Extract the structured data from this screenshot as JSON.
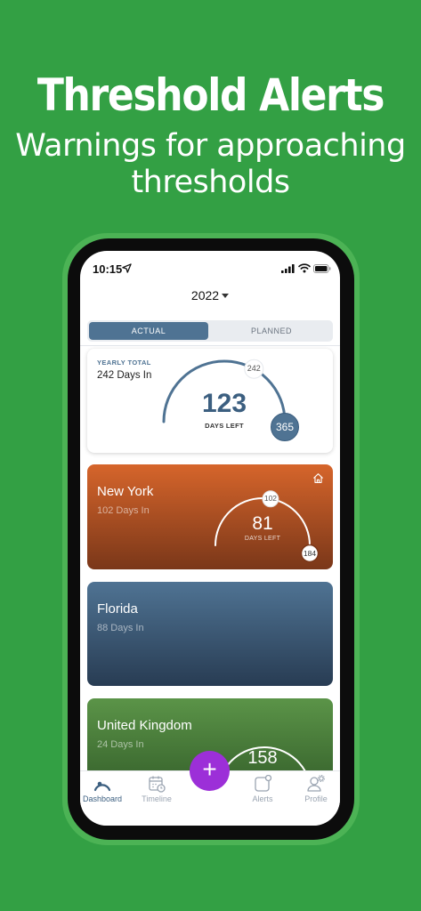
{
  "promo": {
    "title": "Threshold Alerts",
    "subtitle_line1": "Warnings for approaching",
    "subtitle_line2": "thresholds"
  },
  "status_bar": {
    "time": "10:15"
  },
  "year_selector": {
    "value": "2022"
  },
  "segmented": {
    "actual": "ACTUAL",
    "planned": "PLANNED",
    "selected": "ACTUAL"
  },
  "yearly_total": {
    "label": "YEARLY TOTAL",
    "days_in": "242 Days In",
    "days_left": "123",
    "days_left_label": "DAYS LEFT",
    "current_marker": "242",
    "max_marker": "365",
    "progress": 0.663
  },
  "locations": [
    {
      "name": "New York",
      "days_in": "102 Days In",
      "days_left": "81",
      "days_left_label": "DAYS LEFT",
      "current_marker": "102",
      "max_marker": "184",
      "home": true,
      "progress": 0.554
    },
    {
      "name": "Florida",
      "days_in": "88 Days In"
    },
    {
      "name": "United Kingdom",
      "days_in": "24 Days In",
      "days_left": "158"
    }
  ],
  "tabs": [
    {
      "label": "Dashboard",
      "icon": "dashboard-gauge-icon",
      "active": true
    },
    {
      "label": "Timeline",
      "icon": "calendar-clock-icon",
      "active": false
    },
    {
      "label": "Alerts",
      "icon": "alert-square-icon",
      "active": false
    },
    {
      "label": "Profile",
      "icon": "user-gear-icon",
      "active": false
    }
  ],
  "fab": {
    "label": "+"
  },
  "colors": {
    "background": "#33a044",
    "accent_blue": "#4f7393",
    "new_york": "#d6652b",
    "florida": "#4f7393",
    "united_kingdom": "#5b9448",
    "fab": "#9c2fd8"
  }
}
